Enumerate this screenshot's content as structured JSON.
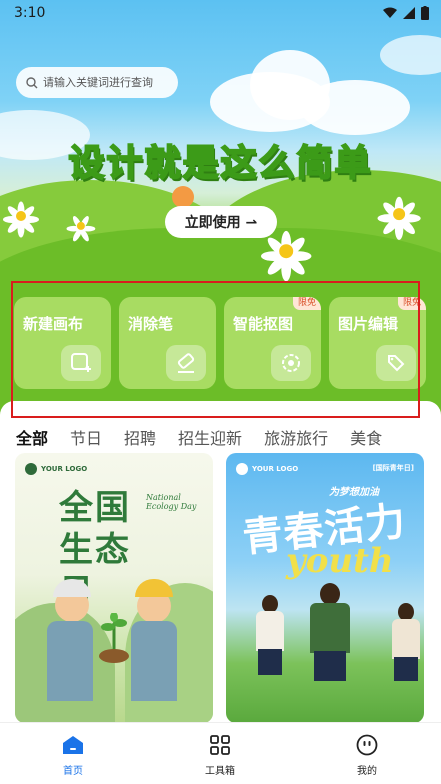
{
  "status_bar": {
    "time": "3:10"
  },
  "hero": {
    "search_placeholder": "请输入关键词进行查询",
    "slogan": "设计就是这么简单",
    "cta_label": "立即使用 ⇀"
  },
  "tools": [
    {
      "label": "新建画布",
      "icon": "canvas-add-icon",
      "badge": ""
    },
    {
      "label": "消除笔",
      "icon": "eraser-icon",
      "badge": ""
    },
    {
      "label": "智能抠图",
      "icon": "cutout-icon",
      "badge": "限免"
    },
    {
      "label": "图片编辑",
      "icon": "image-edit-icon",
      "badge": "限免"
    }
  ],
  "categories": [
    "全部",
    "节日",
    "招聘",
    "招生迎新",
    "旅游旅行",
    "美食"
  ],
  "active_category": "全部",
  "templates": [
    {
      "logo": "YOUR LOGO",
      "title": "全国生态日",
      "subtitle": "National Ecology Day"
    },
    {
      "logo": "YOUR LOGO",
      "tag": "[国际青年日]",
      "slogan": "为梦想加油",
      "title": "青春活力",
      "word": "youth"
    }
  ],
  "bottom_nav": [
    {
      "label": "首页",
      "icon": "home-icon",
      "active": true
    },
    {
      "label": "工具箱",
      "icon": "grid-icon",
      "active": false
    },
    {
      "label": "我的",
      "icon": "face-icon",
      "active": false
    }
  ],
  "colors": {
    "accent": "#1a73e8",
    "highlight_box": "#d91d1d",
    "badge_text": "#d9502a"
  }
}
